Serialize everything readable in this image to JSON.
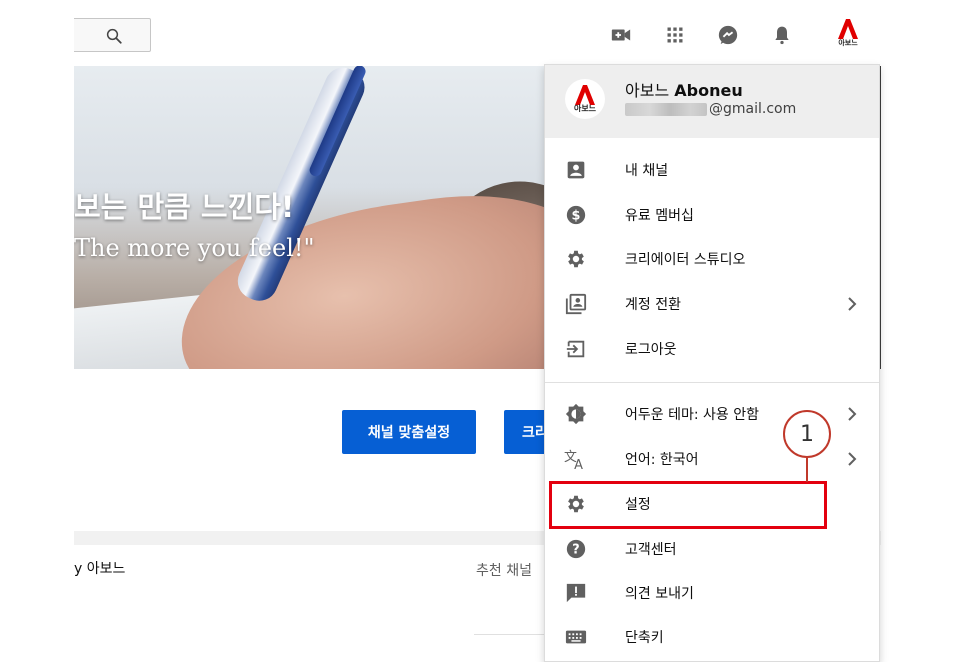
{
  "topbar": {
    "icons": [
      "video-camera-plus-icon",
      "apps-grid-icon",
      "messages-icon",
      "notifications-bell-icon"
    ],
    "avatar_label": "아보느"
  },
  "banner": {
    "slogan_ko": "보는 만큼 느낀다!",
    "slogan_en": "The more you feel!\""
  },
  "page": {
    "customize_button": "채널 맞춤설정",
    "second_button": "크리",
    "by_line": "y 아보느",
    "recommended": "추천 채널"
  },
  "menu": {
    "account": {
      "name_ko": "아보느",
      "name_en": "Aboneu",
      "email_suffix": "@gmail.com",
      "avatar_label": "아보느"
    },
    "items": [
      {
        "label": "내 채널",
        "icon": "account-box-icon"
      },
      {
        "label": "유료 멤버십",
        "icon": "dollar-circle-icon"
      },
      {
        "label": "크리에이터 스튜디오",
        "icon": "gear-icon"
      },
      {
        "label": "계정 전환",
        "icon": "switch-account-icon",
        "chevron": true
      },
      {
        "label": "로그아웃",
        "icon": "sign-out-icon"
      },
      {
        "label": "어두운 테마: 사용 안함",
        "icon": "dark-theme-icon",
        "chevron": true
      },
      {
        "label": "언어: 한국어",
        "icon": "translate-icon",
        "chevron": true
      },
      {
        "label": "설정",
        "icon": "settings-gear-icon",
        "highlighted": true
      },
      {
        "label": "고객센터",
        "icon": "help-icon"
      },
      {
        "label": "의견 보내기",
        "icon": "feedback-icon"
      },
      {
        "label": "단축키",
        "icon": "keyboard-icon"
      }
    ]
  },
  "annotation": {
    "step_number": "1",
    "highlight_color": "#e3000f"
  },
  "colors": {
    "primary_blue": "#065fd4",
    "brand_red": "#e00000",
    "menu_header_bg": "#eeeeee",
    "icon_grey": "#606060"
  }
}
